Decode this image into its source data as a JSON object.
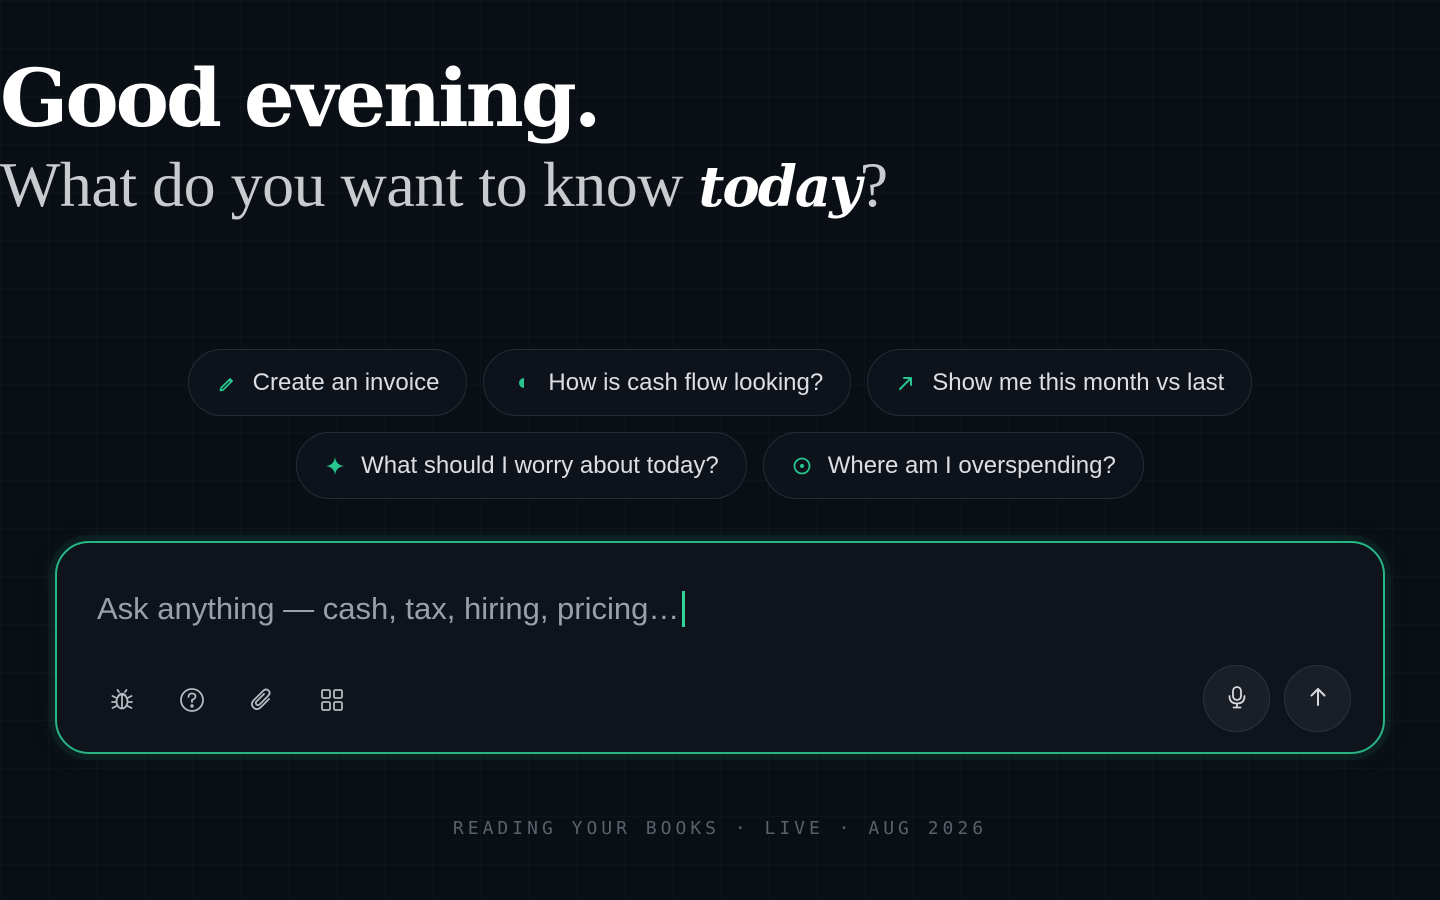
{
  "hero": {
    "greeting": "Good evening.",
    "question_prefix": "What do you want to know ",
    "question_emphasis": "today",
    "question_suffix": "?"
  },
  "suggestions": [
    {
      "label": "Create an invoice",
      "icon": "pencil-icon"
    },
    {
      "label": "How is cash flow looking?",
      "icon": "half-circle-icon"
    },
    {
      "label": "Show me this month vs last",
      "icon": "trend-arrow-icon"
    },
    {
      "label": "What should I worry about today?",
      "icon": "sparkle-icon"
    },
    {
      "label": "Where am I overspending?",
      "icon": "target-icon"
    }
  ],
  "composer": {
    "placeholder": "Ask anything — cash, tax, hiring, pricing…",
    "tools": [
      "bug-icon",
      "help-icon",
      "paperclip-icon",
      "grid-icon"
    ],
    "actions": [
      "microphone-icon",
      "send-arrow-icon"
    ]
  },
  "footer": {
    "status": "READING YOUR BOOKS · LIVE · AUG 2026"
  },
  "colors": {
    "background": "#0a0e15",
    "accent": "#27b584",
    "chip_border": "#262c35",
    "muted_text": "#5b616a"
  }
}
